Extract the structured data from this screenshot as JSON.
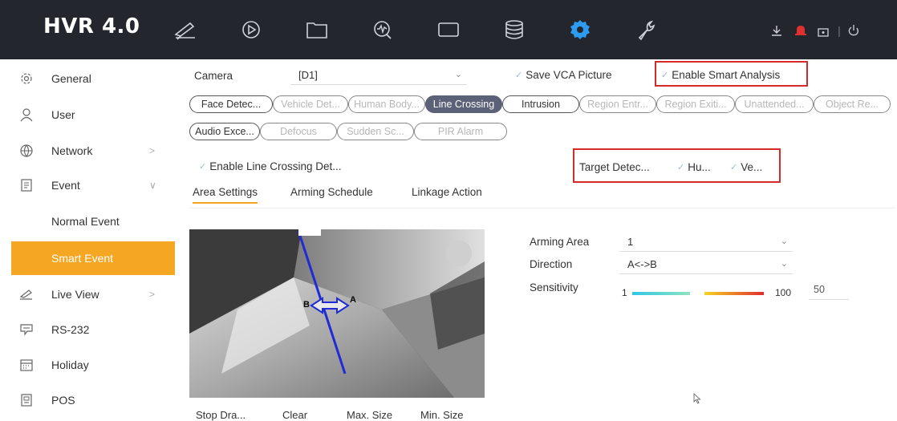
{
  "app": {
    "title": "HVR 4.0"
  },
  "topbar": {
    "nav_icons": [
      "live-view-icon",
      "playback-icon",
      "file-icon",
      "search-icon",
      "screen-icon",
      "storage-icon",
      "settings-icon",
      "maintenance-icon"
    ],
    "active_index": 6,
    "right_icons": [
      "download-icon",
      "alarm-icon",
      "lock-icon",
      "power-icon"
    ],
    "accent_active": "#2d9bf0",
    "alarm_color": "#e03131"
  },
  "sidebar": {
    "items": [
      {
        "label": "General",
        "icon": "gear-icon"
      },
      {
        "label": "User",
        "icon": "user-icon"
      },
      {
        "label": "Network",
        "icon": "globe-icon",
        "arrow": ">"
      },
      {
        "label": "Event",
        "icon": "clipboard-icon",
        "arrow": "∨"
      },
      {
        "label": "Normal Event"
      },
      {
        "label": "Smart Event"
      },
      {
        "label": "Live View",
        "icon": "camera-icon",
        "arrow": ">"
      },
      {
        "label": "RS-232",
        "icon": "chat-icon"
      },
      {
        "label": "Holiday",
        "icon": "calendar-icon"
      },
      {
        "label": "POS",
        "icon": "pos-icon"
      }
    ],
    "active_color": "#f5a623"
  },
  "main": {
    "camera_label": "Camera",
    "camera_value": "[D1]",
    "save_vca": "Save VCA Picture",
    "enable_smart": "Enable Smart Analysis",
    "pills_row1": [
      {
        "label": "Face Detec...",
        "state": "normal"
      },
      {
        "label": "Vehicle Det...",
        "state": "dim"
      },
      {
        "label": "Human Body...",
        "state": "dim"
      },
      {
        "label": "Line Crossing",
        "state": "on"
      },
      {
        "label": "Intrusion",
        "state": "normal"
      },
      {
        "label": "Region Entr...",
        "state": "dim"
      },
      {
        "label": "Region Exiti...",
        "state": "dim"
      },
      {
        "label": "Unattended...",
        "state": "dim"
      },
      {
        "label": "Object Re...",
        "state": "dim"
      }
    ],
    "pills_row2": [
      {
        "label": "Audio Exce...",
        "state": "normal"
      },
      {
        "label": "Defocus",
        "state": "dim"
      },
      {
        "label": "Sudden Sc...",
        "state": "dim"
      },
      {
        "label": "PIR Alarm",
        "state": "dim"
      }
    ],
    "enable_line": "Enable Line Crossing Det...",
    "target_label": "Target Detec...",
    "target_opt1": "Hu...",
    "target_opt2": "Ve...",
    "tabs": [
      "Area Settings",
      "Arming Schedule",
      "Linkage Action"
    ],
    "active_tab": 0,
    "arming_area_label": "Arming Area",
    "arming_area_value": "1",
    "direction_label": "Direction",
    "direction_value": "A<->B",
    "sensitivity_label": "Sensitivity",
    "sensitivity_min": "1",
    "sensitivity_max": "100",
    "sensitivity_value": "50",
    "video_line_a": "A",
    "video_line_b": "B",
    "buttons": [
      "Stop Dra...",
      "Clear",
      "Max. Size",
      "Min. Size"
    ]
  }
}
